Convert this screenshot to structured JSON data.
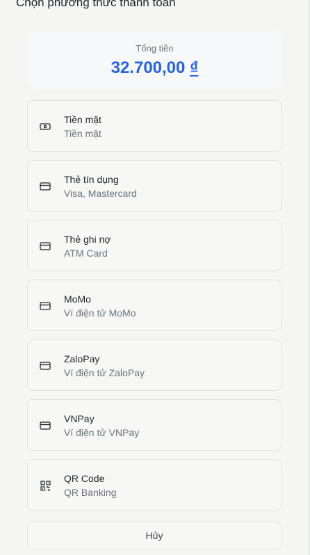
{
  "header": {
    "title": "Chọn phương thức thanh toán"
  },
  "total": {
    "label": "Tổng tiền",
    "amount": "32.700,00",
    "currency": "₫"
  },
  "methods": [
    {
      "name": "Tiền mặt",
      "desc": "Tiền mặt",
      "icon": "cash-icon"
    },
    {
      "name": "Thẻ tín dụng",
      "desc": "Visa, Mastercard",
      "icon": "credit-card-icon"
    },
    {
      "name": "Thẻ ghi nợ",
      "desc": "ATM Card",
      "icon": "credit-card-icon"
    },
    {
      "name": "MoMo",
      "desc": "Ví điện tử MoMo",
      "icon": "credit-card-icon"
    },
    {
      "name": "ZaloPay",
      "desc": "Ví điện tử ZaloPay",
      "icon": "credit-card-icon"
    },
    {
      "name": "VNPay",
      "desc": "Ví điện tử VNPay",
      "icon": "credit-card-icon"
    },
    {
      "name": "QR Code",
      "desc": "QR Banking",
      "icon": "qr-code-icon"
    }
  ],
  "actions": {
    "cancel_label": "Hủy"
  },
  "colors": {
    "accent": "#2563eb",
    "background": "#f5f6f4",
    "border": "#dfe2df"
  }
}
